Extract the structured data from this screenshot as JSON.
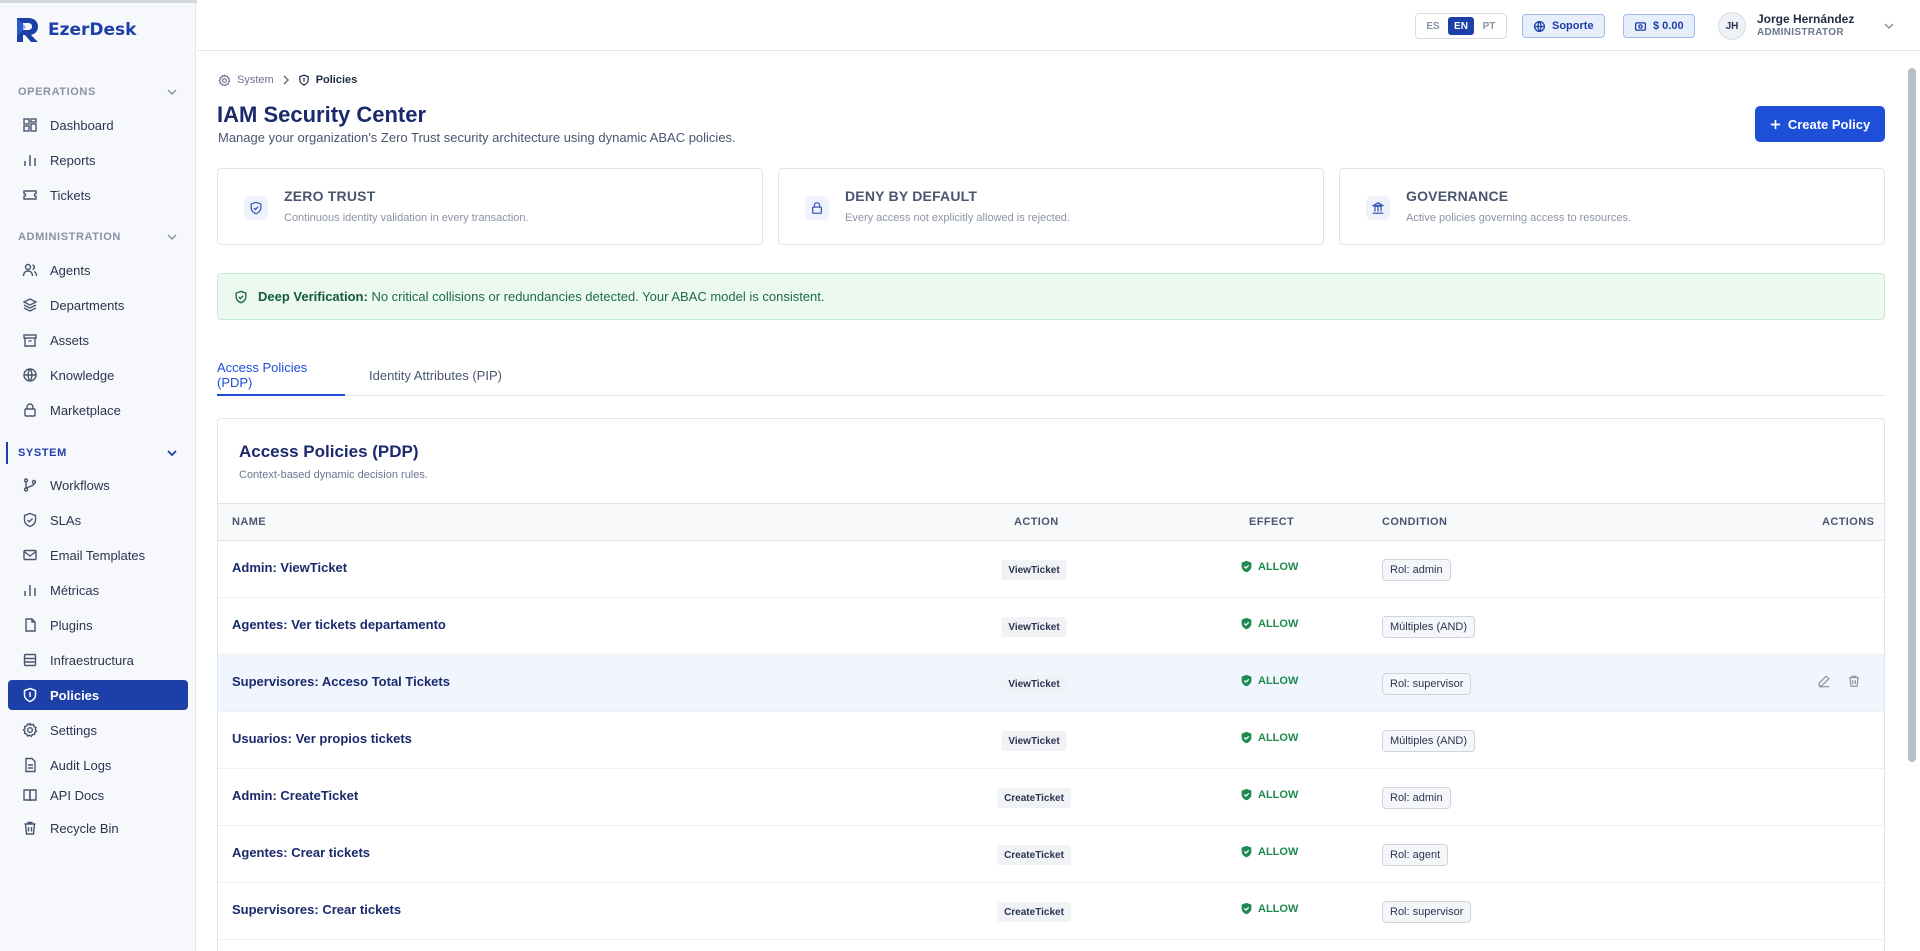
{
  "app": {
    "name": "EzerDesk"
  },
  "sidebar": {
    "sections": [
      {
        "label": "OPERATIONS",
        "items": [
          {
            "label": "Dashboard",
            "icon": "dashboard-icon"
          },
          {
            "label": "Reports",
            "icon": "bar-chart-icon"
          },
          {
            "label": "Tickets",
            "icon": "ticket-icon"
          }
        ]
      },
      {
        "label": "ADMINISTRATION",
        "items": [
          {
            "label": "Agents",
            "icon": "users-icon"
          },
          {
            "label": "Departments",
            "icon": "layers-icon"
          },
          {
            "label": "Assets",
            "icon": "archive-icon"
          },
          {
            "label": "Knowledge",
            "icon": "globe-icon"
          },
          {
            "label": "Marketplace",
            "icon": "lock-icon"
          }
        ]
      },
      {
        "label": "SYSTEM",
        "items": [
          {
            "label": "Workflows",
            "icon": "git-branch-icon"
          },
          {
            "label": "SLAs",
            "icon": "shield-check-icon"
          },
          {
            "label": "Email Templates",
            "icon": "mail-icon"
          },
          {
            "label": "Métricas",
            "icon": "bar-chart-icon"
          },
          {
            "label": "Plugins",
            "icon": "plug-icon"
          },
          {
            "label": "Infraestructura",
            "icon": "server-icon"
          },
          {
            "label": "Policies",
            "icon": "shield-icon",
            "active": true
          },
          {
            "label": "Settings",
            "icon": "gear-icon"
          },
          {
            "label": "Audit Logs",
            "icon": "file-text-icon"
          },
          {
            "label": "API Docs",
            "icon": "book-icon"
          },
          {
            "label": "Recycle Bin",
            "icon": "trash-icon"
          }
        ]
      }
    ]
  },
  "topbar": {
    "languages": [
      "ES",
      "EN",
      "PT"
    ],
    "active_language": "EN",
    "support_label": "Soporte",
    "balance_label": "$ 0.00",
    "user": {
      "initials": "JH",
      "name": "Jorge Hernández",
      "role": "ADMINISTRATOR"
    }
  },
  "breadcrumb": {
    "parent": "System",
    "current": "Policies"
  },
  "page": {
    "title": "IAM Security Center",
    "subtitle": "Manage your organization's Zero Trust security architecture using dynamic ABAC policies.",
    "create_button": "Create Policy"
  },
  "cards": [
    {
      "title": "ZERO TRUST",
      "description": "Continuous identity validation in every transaction.",
      "icon": "shield-check-icon"
    },
    {
      "title": "DENY BY DEFAULT",
      "description": "Every access not explicitly allowed is rejected.",
      "icon": "lock-icon"
    },
    {
      "title": "GOVERNANCE",
      "description": "Active policies governing access to resources.",
      "icon": "building-icon"
    }
  ],
  "alert": {
    "strong": "Deep Verification:",
    "text": "No critical collisions or redundancies detected. Your ABAC model is consistent."
  },
  "tabs": [
    {
      "label": "Access Policies (PDP)",
      "active": true
    },
    {
      "label": "Identity Attributes (PIP)",
      "active": false
    }
  ],
  "table": {
    "title": "Access Policies (PDP)",
    "subtitle": "Context-based dynamic decision rules.",
    "columns": {
      "name": "NAME",
      "action": "ACTION",
      "effect": "EFFECT",
      "condition": "CONDITION",
      "actions": "ACTIONS"
    },
    "rows": [
      {
        "name": "Admin: ViewTicket",
        "action": "ViewTicket",
        "effect": "ALLOW",
        "condition": "Rol: admin"
      },
      {
        "name": "Agentes: Ver tickets departamento",
        "action": "ViewTicket",
        "effect": "ALLOW",
        "condition": "Múltiples (AND)"
      },
      {
        "name": "Supervisores: Acceso Total Tickets",
        "action": "ViewTicket",
        "effect": "ALLOW",
        "condition": "Rol: supervisor",
        "hovered": true
      },
      {
        "name": "Usuarios: Ver propios tickets",
        "action": "ViewTicket",
        "effect": "ALLOW",
        "condition": "Múltiples (AND)"
      },
      {
        "name": "Admin: CreateTicket",
        "action": "CreateTicket",
        "effect": "ALLOW",
        "condition": "Rol: admin"
      },
      {
        "name": "Agentes: Crear tickets",
        "action": "CreateTicket",
        "effect": "ALLOW",
        "condition": "Rol: agent"
      },
      {
        "name": "Supervisores: Crear tickets",
        "action": "CreateTicket",
        "effect": "ALLOW",
        "condition": "Rol: supervisor"
      }
    ]
  },
  "colors": {
    "brand": "#1d3fa8",
    "primary_button": "#1d4fd8",
    "allow": "#1f8a4f",
    "alert_bg": "#ecf9f1"
  }
}
